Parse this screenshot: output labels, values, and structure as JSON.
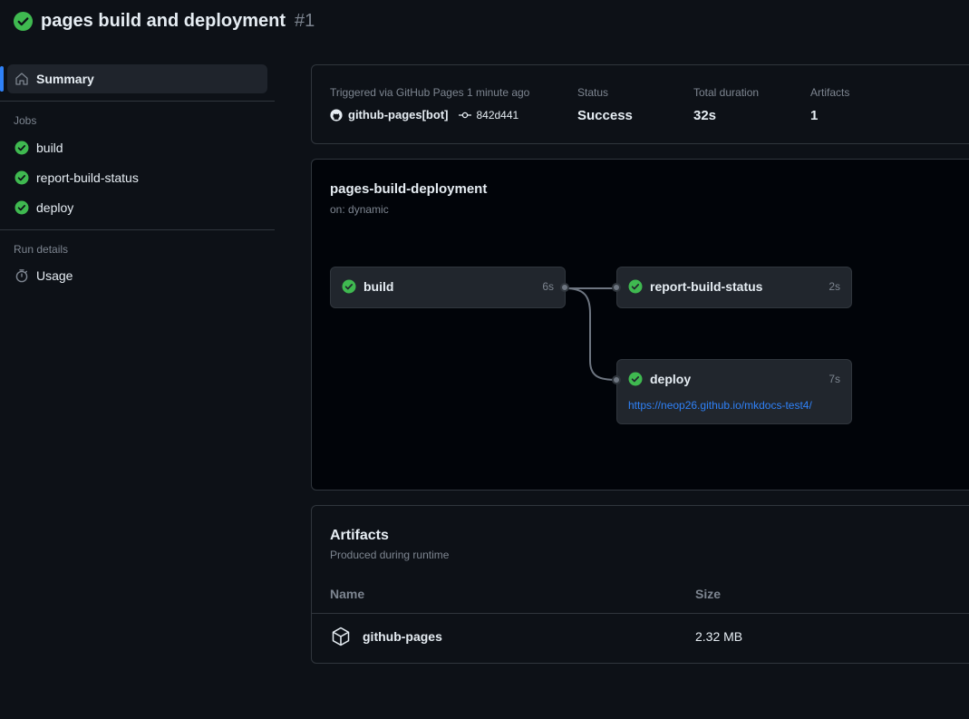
{
  "header": {
    "title": "pages build and deployment",
    "run_number": "#1"
  },
  "sidebar": {
    "summary_label": "Summary",
    "jobs_heading": "Jobs",
    "jobs": [
      {
        "label": "build"
      },
      {
        "label": "report-build-status"
      },
      {
        "label": "deploy"
      }
    ],
    "run_details_heading": "Run details",
    "usage_label": "Usage"
  },
  "summary": {
    "trigger_text": "Triggered via GitHub Pages 1 minute ago",
    "actor": "github-pages[bot]",
    "commit": "842d441",
    "status_label": "Status",
    "status_value": "Success",
    "duration_label": "Total duration",
    "duration_value": "32s",
    "artifacts_label": "Artifacts",
    "artifacts_value": "1"
  },
  "graph": {
    "workflow_name": "pages-build-deployment",
    "trigger": "on: dynamic",
    "jobs": [
      {
        "name": "build",
        "duration": "6s"
      },
      {
        "name": "report-build-status",
        "duration": "2s"
      },
      {
        "name": "deploy",
        "duration": "7s",
        "url": "https://neop26.github.io/mkdocs-test4/"
      }
    ]
  },
  "artifacts": {
    "title": "Artifacts",
    "subtitle": "Produced during runtime",
    "col_name": "Name",
    "col_size": "Size",
    "rows": [
      {
        "name": "github-pages",
        "size": "2.32 MB"
      }
    ]
  },
  "colors": {
    "success": "#3fb950",
    "accent": "#2f81f7",
    "background": "#0d1117"
  }
}
